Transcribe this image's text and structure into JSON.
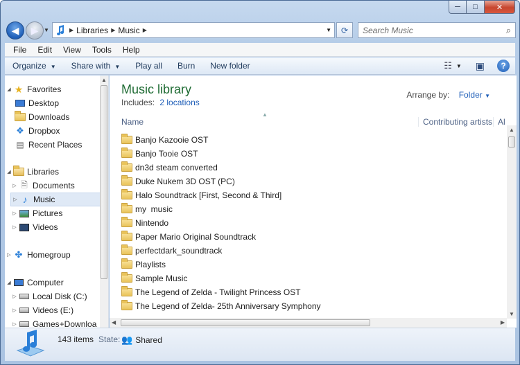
{
  "window": {
    "min": "─",
    "max": "□",
    "close": "✕"
  },
  "address": {
    "crumbs": [
      "Libraries",
      "Music"
    ]
  },
  "search": {
    "placeholder": "Search Music"
  },
  "menu": [
    "File",
    "Edit",
    "View",
    "Tools",
    "Help"
  ],
  "commands": {
    "organize": "Organize",
    "share": "Share with",
    "play": "Play all",
    "burn": "Burn",
    "newfolder": "New folder"
  },
  "nav": {
    "favorites": "Favorites",
    "desktop": "Desktop",
    "downloads": "Downloads",
    "dropbox": "Dropbox",
    "recent": "Recent Places",
    "libraries": "Libraries",
    "documents": "Documents",
    "music": "Music",
    "pictures": "Pictures",
    "videos": "Videos",
    "homegroup": "Homegroup",
    "computer": "Computer",
    "localc": "Local Disk (C:)",
    "videose": "Videos (E:)",
    "games": "Games+Downloa"
  },
  "content": {
    "title": "Music library",
    "includes_label": "Includes:",
    "includes_link": "2 locations",
    "arrange_label": "Arrange by:",
    "arrange_value": "Folder",
    "col_name": "Name",
    "col_artists": "Contributing artists",
    "col_album": "Al",
    "folders": [
      "Banjo Kazooie OST",
      "Banjo Tooie OST",
      "dn3d steam converted",
      "Duke Nukem 3D OST (PC)",
      "Halo Soundtrack [First, Second & Third]",
      "my  music",
      "Nintendo",
      "Paper Mario Original Soundtrack",
      "perfectdark_soundtrack",
      "Playlists",
      "Sample Music",
      "The Legend of Zelda - Twilight Princess OST",
      "The Legend of Zelda- 25th Anniversary Symphony"
    ]
  },
  "details": {
    "count": "143 items",
    "state_label": "State:",
    "state_value": "Shared"
  }
}
